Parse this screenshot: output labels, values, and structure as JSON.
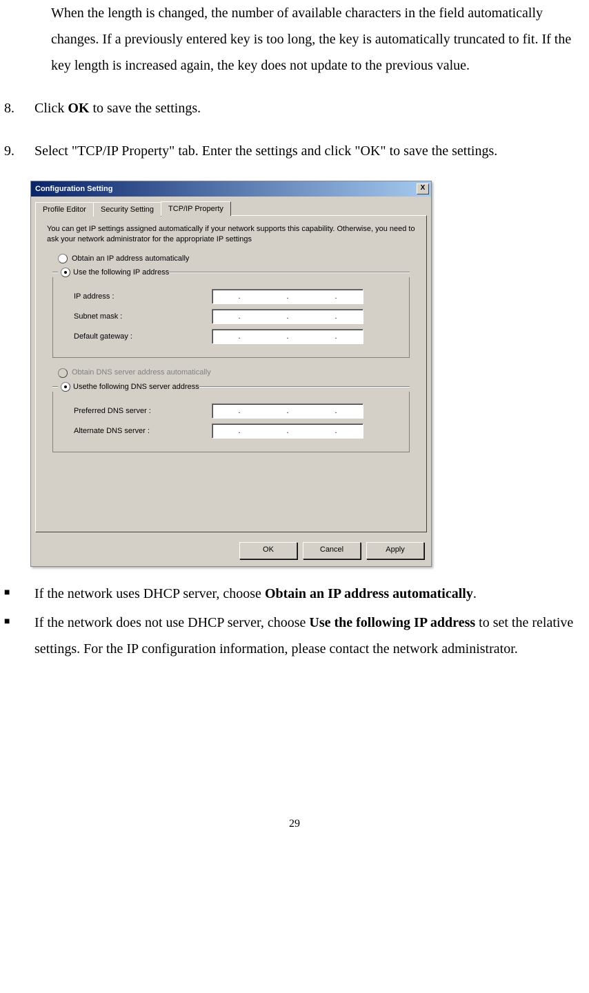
{
  "para_top": "When the length is changed, the number of available characters in the field automatically changes. If a previously entered key is too long, the key is automatically truncated to fit. If the key length is increased again, the key does not update to the previous value.",
  "step8": {
    "num": "8.",
    "pre": "Click ",
    "bold": "OK",
    "post": " to save the settings."
  },
  "step9": {
    "num": "9.",
    "text": "Select \"TCP/IP Property\" tab.  Enter the settings and click \"OK\" to save the settings."
  },
  "dialog": {
    "title": "Configuration Setting",
    "close": "X",
    "tabs": {
      "t1": "Profile Editor",
      "t2": "Security Setting",
      "t3": "TCP/IP Property"
    },
    "desc": "You can get IP settings assigned automatically if your network supports this capability. Otherwise, you need to ask your network administrator for the appropriate IP settings",
    "radio_obtain_ip": "Obtain an IP address automatically",
    "radio_use_ip": "Use the following IP address",
    "fields_ip": {
      "ip": "IP address :",
      "subnet": "Subnet mask :",
      "gateway": "Default gateway :"
    },
    "radio_obtain_dns": "Obtain DNS server address automatically",
    "radio_use_dns": "Usethe following DNS server address",
    "fields_dns": {
      "pref": "Preferred DNS server :",
      "alt": "Alternate DNS server :"
    },
    "buttons": {
      "ok": "OK",
      "cancel": "Cancel",
      "apply": "Apply"
    }
  },
  "bullet1": {
    "pre": "If the network uses DHCP server, choose ",
    "bold": "Obtain an IP address automatically",
    "post": "."
  },
  "bullet2": {
    "pre": "If the network does not use DHCP server, choose ",
    "bold": "Use the following IP address",
    "post": " to set the relative settings.  For the IP configuration information, please contact the network administrator."
  },
  "page_number": "29"
}
